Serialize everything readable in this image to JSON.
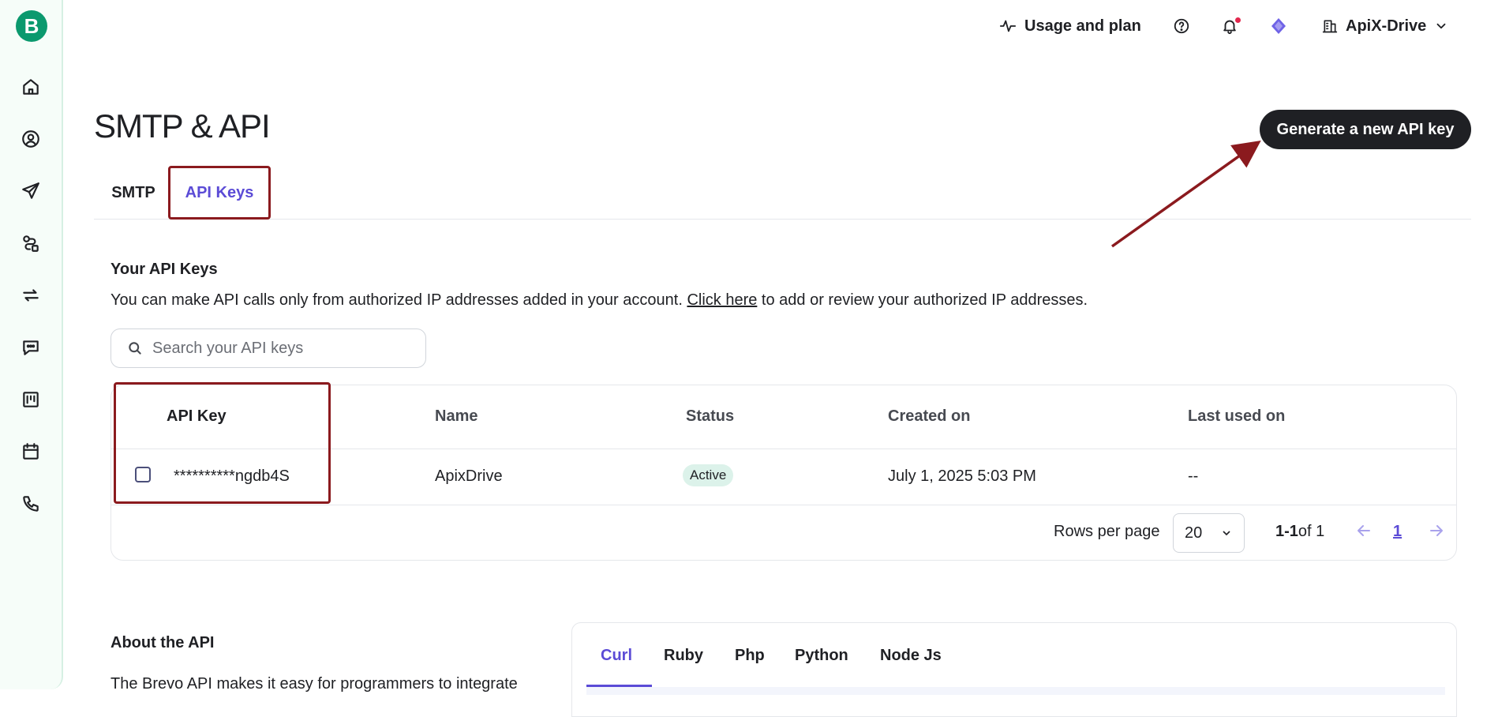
{
  "sidebar": {
    "logo_letter": "B",
    "items": [
      {
        "name": "home-icon"
      },
      {
        "name": "contacts-icon"
      },
      {
        "name": "campaigns-icon"
      },
      {
        "name": "automations-icon"
      },
      {
        "name": "transactional-icon"
      },
      {
        "name": "conversations-icon"
      },
      {
        "name": "crm-icon"
      },
      {
        "name": "meetings-icon"
      },
      {
        "name": "phone-icon"
      }
    ]
  },
  "header": {
    "usage_label": "Usage and plan",
    "account_name": "ApiX-Drive"
  },
  "page": {
    "title": "SMTP & API",
    "generate_button": "Generate a new API key"
  },
  "tabs": [
    {
      "label": "SMTP",
      "active": false
    },
    {
      "label": "API Keys",
      "active": true
    }
  ],
  "api_keys": {
    "section_title": "Your API Keys",
    "desc_before": "You can make API calls only from authorized IP addresses added in your account. ",
    "desc_link": "Click here",
    "desc_after": " to add or review your authorized IP addresses.",
    "search_placeholder": "Search your API keys",
    "columns": [
      "API Key",
      "Name",
      "Status",
      "Created on",
      "Last used on"
    ],
    "rows": [
      {
        "key": "**********ngdb4S",
        "name": "ApixDrive",
        "status": "Active",
        "created": "July 1, 2025 5:03 PM",
        "last_used": "--"
      }
    ],
    "pager": {
      "rows_label": "Rows per page",
      "rows_value": "20",
      "range_bold": "1-1",
      "range_rest": " of 1",
      "page": "1"
    }
  },
  "about": {
    "title": "About the API",
    "desc": "The Brevo API makes it easy for programmers to integrate",
    "code_tabs": [
      "Curl",
      "Ruby",
      "Php",
      "Python",
      "Node Js"
    ]
  },
  "colors": {
    "brand": "#0b996e",
    "accent": "#5b4bd6",
    "annotation": "#8b1a1e"
  }
}
